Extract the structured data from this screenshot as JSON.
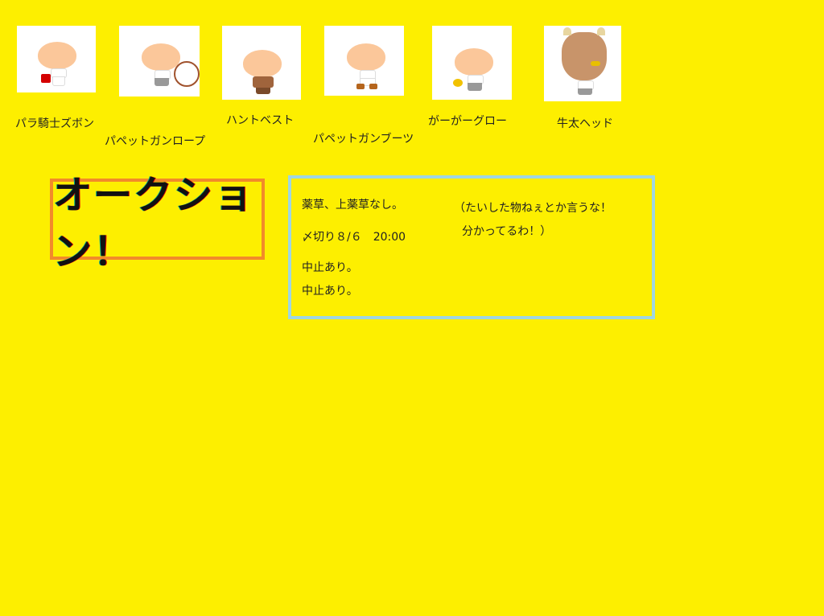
{
  "colors": {
    "background": "#FDEF00",
    "title_border": "#F28A2A",
    "info_border": "#9FD6E2",
    "skin": "#FBC79A",
    "thumb_bg": "#FFFFFF"
  },
  "items": [
    {
      "name": "パラ騎士ズボン",
      "icon": "avatar-red-pants-icon"
    },
    {
      "name": "パペットガンロープ",
      "icon": "avatar-rope-icon"
    },
    {
      "name": "ハントベスト",
      "icon": "avatar-vest-icon"
    },
    {
      "name": "パペットガンブーツ",
      "icon": "avatar-boots-icon"
    },
    {
      "name": "がーがーグロー",
      "icon": "avatar-duck-glove-icon"
    },
    {
      "name": "牛太ヘッド",
      "icon": "avatar-cow-head-icon"
    }
  ],
  "title": {
    "text": "オークション！"
  },
  "info": {
    "note1": "薬草、上薬草なし。",
    "deadline": "〆切り８/６　20:00",
    "cancel1": "中止あり。",
    "cancel2": "中止あり。",
    "aside1": "（たいした物ねぇとか言うな！",
    "aside2": "分かってるわ！）"
  }
}
